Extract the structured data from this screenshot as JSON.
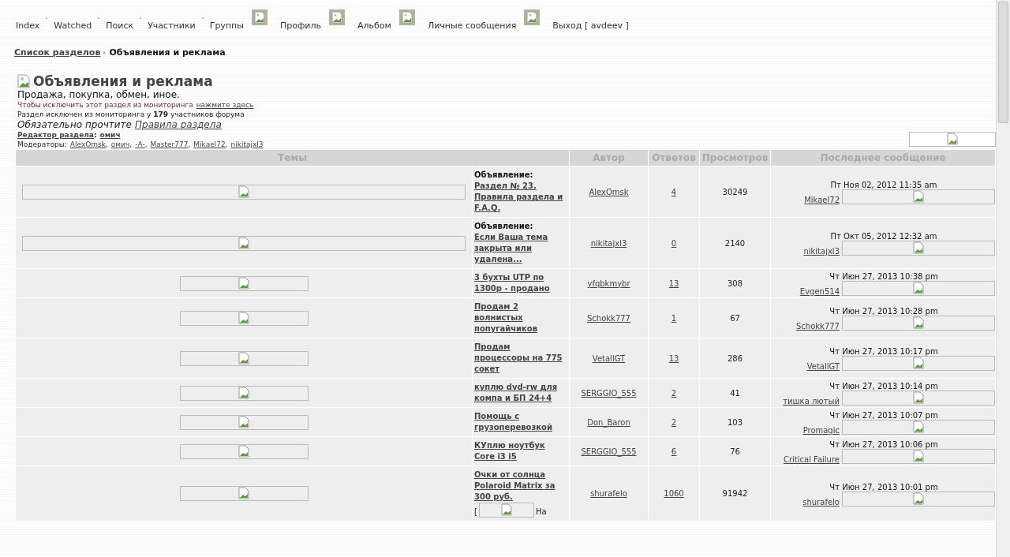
{
  "nav": [
    {
      "kind": "link",
      "label": "Index"
    },
    {
      "kind": "dot"
    },
    {
      "kind": "link",
      "label": "Watched"
    },
    {
      "kind": "dot"
    },
    {
      "kind": "link",
      "label": "Поиск"
    },
    {
      "kind": "dot"
    },
    {
      "kind": "link",
      "label": "Участники"
    },
    {
      "kind": "dot"
    },
    {
      "kind": "link",
      "label": "Группы"
    },
    {
      "kind": "image"
    },
    {
      "kind": "link",
      "label": "Профиль"
    },
    {
      "kind": "image"
    },
    {
      "kind": "link",
      "label": "Альбом"
    },
    {
      "kind": "image"
    },
    {
      "kind": "link",
      "label": "Личные сообщения"
    },
    {
      "kind": "image"
    },
    {
      "kind": "link",
      "label": "Выход [ avdeev ]"
    }
  ],
  "breadcrumb": {
    "link": "Список разделов",
    "current": "Объявления и реклама"
  },
  "forum": {
    "title": "Объявления и реклама",
    "description": "Продажа, покупка, обмен, иное.",
    "unwatch_text": "Чтобы исключить этот раздел из мониторинга",
    "unwatch_link": "нажмите здесь",
    "watch_count": "Раздел исключен из мониторинга у **179** участников форума",
    "rules_text": "Обязательно прочтите",
    "rules_link": "Правила раздела",
    "editor_label": "Редактор раздела",
    "editor_colon": ":",
    "editor_name": "омич",
    "moderators_label": "Модераторы:",
    "moderators": [
      {
        "name": "AlexOmsk",
        "sep": ","
      },
      {
        "name": "омич",
        "sep": ","
      },
      {
        "name": "-A-",
        "sep": ","
      },
      {
        "name": "Master777",
        "sep": ","
      },
      {
        "name": "Mikael72",
        "sep": ","
      },
      {
        "name": "nikitajxl3"
      }
    ]
  },
  "table": {
    "columns": [
      "Темы",
      "Автор",
      "Ответов",
      "Просмотров",
      "Последнее сообщение"
    ],
    "rows": [
      {
        "kind": "announcement",
        "prefix": "Объявление:",
        "title": "Раздел № 23. Правила раздела и F.A.Q.",
        "author": "AlexOmsk",
        "replies": "4",
        "views": "30249",
        "last_date": "Пт Ноя 02, 2012 11:35 am",
        "last_author": "Mikael72"
      },
      {
        "kind": "announcement",
        "prefix": "Объявление:",
        "title": "Если Ваша тема закрыта или удалена...",
        "author": "nikitajxl3",
        "replies": "0",
        "views": "2140",
        "last_date": "Пт Окт 05, 2012 12:32 am",
        "last_author": "nikitajxl3"
      },
      {
        "kind": "topic",
        "title": "3 бухты UTP по 1300р - продано",
        "author": "yfqbkmybr",
        "replies": "13",
        "views": "308",
        "last_date": "Чт Июн 27, 2013 10:38 pm",
        "last_author": "Evgen514"
      },
      {
        "kind": "topic",
        "title": "Продам 2 волнистых попугайчиков",
        "author": "Schokk777",
        "replies": "1",
        "views": "67",
        "last_date": "Чт Июн 27, 2013 10:28 pm",
        "last_author": "Schokk777"
      },
      {
        "kind": "topic",
        "title": "Продам процессоры на 775 сокет",
        "author": "VetallGT",
        "replies": "13",
        "views": "286",
        "last_date": "Чт Июн 27, 2013 10:17 pm",
        "last_author": "VetallGT"
      },
      {
        "kind": "topic",
        "title": "куплю dvd-rw для компа и БП 24+4",
        "author": "SERGGIO_555",
        "replies": "2",
        "views": "41",
        "last_date": "Чт Июн 27, 2013 10:14 pm",
        "last_author": "тишка лютый"
      },
      {
        "kind": "topic",
        "title": "Помощь с грузоперевозкой",
        "author": "Don_Baron",
        "replies": "2",
        "views": "103",
        "last_date": "Чт Июн 27, 2013 10:07 pm",
        "last_author": "Promagic"
      },
      {
        "kind": "topic",
        "title": "КУплю ноутбук Core i3 i5",
        "author": "SERGGIO_555",
        "replies": "6",
        "views": "76",
        "last_date": "Чт Июн 27, 2013 10:06 pm",
        "last_author": "Critical Failure"
      },
      {
        "kind": "topic",
        "title": "Очки от солнца Polaroid Matrix за 300 руб.",
        "pages_open": "[",
        "pages_text": "На",
        "author": "shurafelo",
        "replies": "1060",
        "views": "91942",
        "last_date": "Чт Июн 27, 2013 10:01 pm",
        "last_author": "shurafelo"
      }
    ]
  }
}
